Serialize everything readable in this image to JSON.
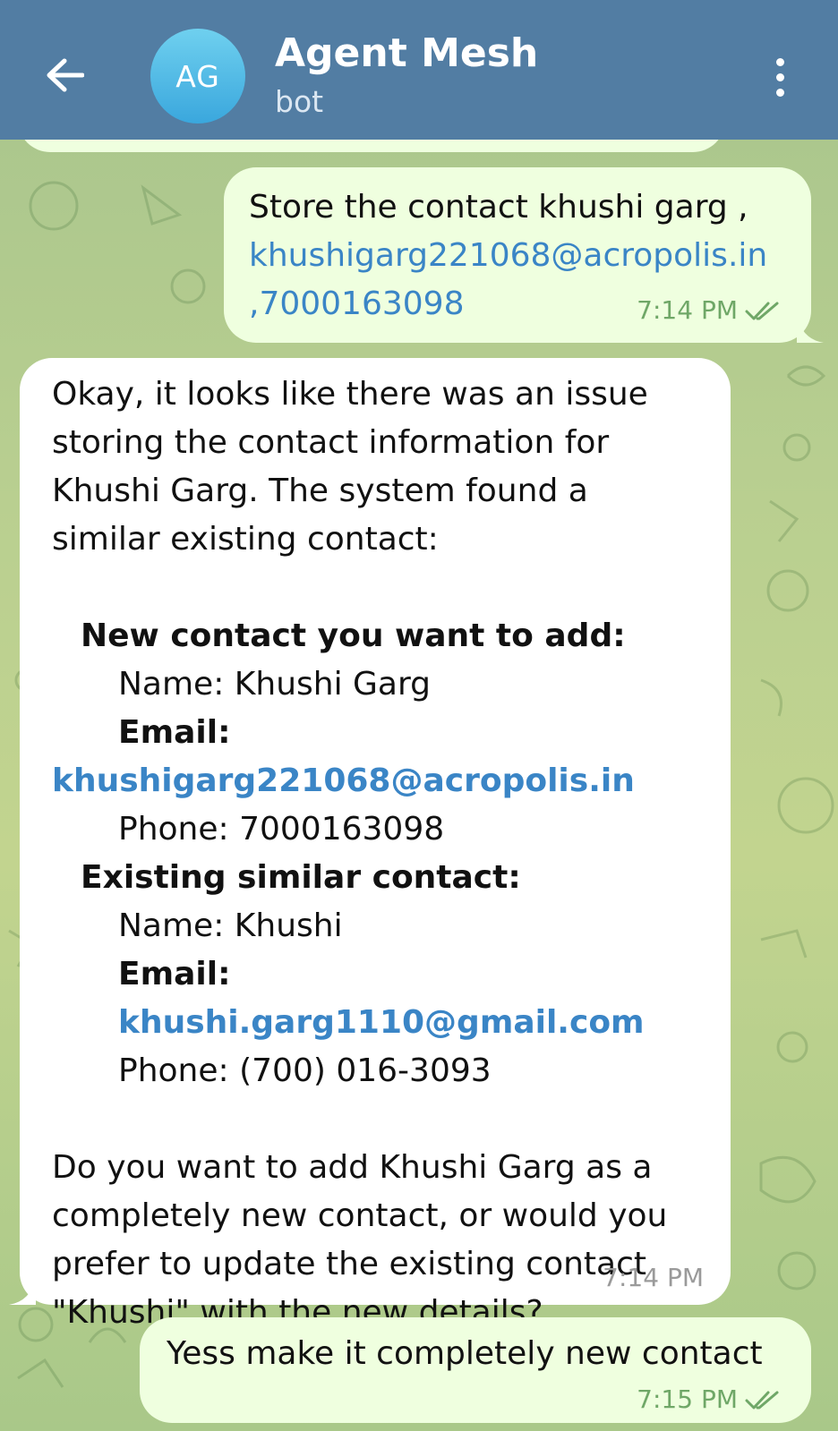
{
  "header": {
    "back_icon": "arrow-left-icon",
    "avatar_initials": "AG",
    "title": "Agent Mesh",
    "subtitle": "bot",
    "menu_icon": "more-vertical-icon",
    "color": "#527da3"
  },
  "messages": {
    "m1": {
      "line1": "Store the contact khushi garg ,",
      "email": "khushigarg221068@acropolis.in",
      "phone": ",7000163098",
      "time": "7:14 PM",
      "status_icon": "double-check-icon"
    },
    "m2": {
      "p1": [
        "Okay, it looks like there was an issue",
        "storing the contact information for",
        "Khushi Garg. The system found a",
        "similar existing contact:"
      ],
      "new_heading": "New contact you want to add:",
      "new_name": "Name: Khushi Garg",
      "new_email_label": "Email:",
      "new_email": "khushigarg221068@acropolis.in",
      "new_phone": "Phone: 7000163098",
      "existing_heading": "Existing similar contact:",
      "existing_name": "Name: Khushi",
      "existing_email_label": "Email:",
      "existing_email": "khushi.garg1110@gmail.com",
      "existing_phone": "Phone: (700) 016-3093",
      "p2": [
        "Do you want to add Khushi Garg as a",
        "completely new contact, or would you",
        "prefer to update the existing contact",
        "\"Khushi\" with the new details?"
      ],
      "time": "7:14 PM"
    },
    "m3": {
      "text": "Yess make it completely new contact",
      "time": "7:15 PM",
      "status_icon": "double-check-icon"
    }
  },
  "colors": {
    "outgoing_bubble": "#efffdf",
    "incoming_bubble": "#ffffff",
    "link": "#3a85c6",
    "check": "#6fa767"
  }
}
